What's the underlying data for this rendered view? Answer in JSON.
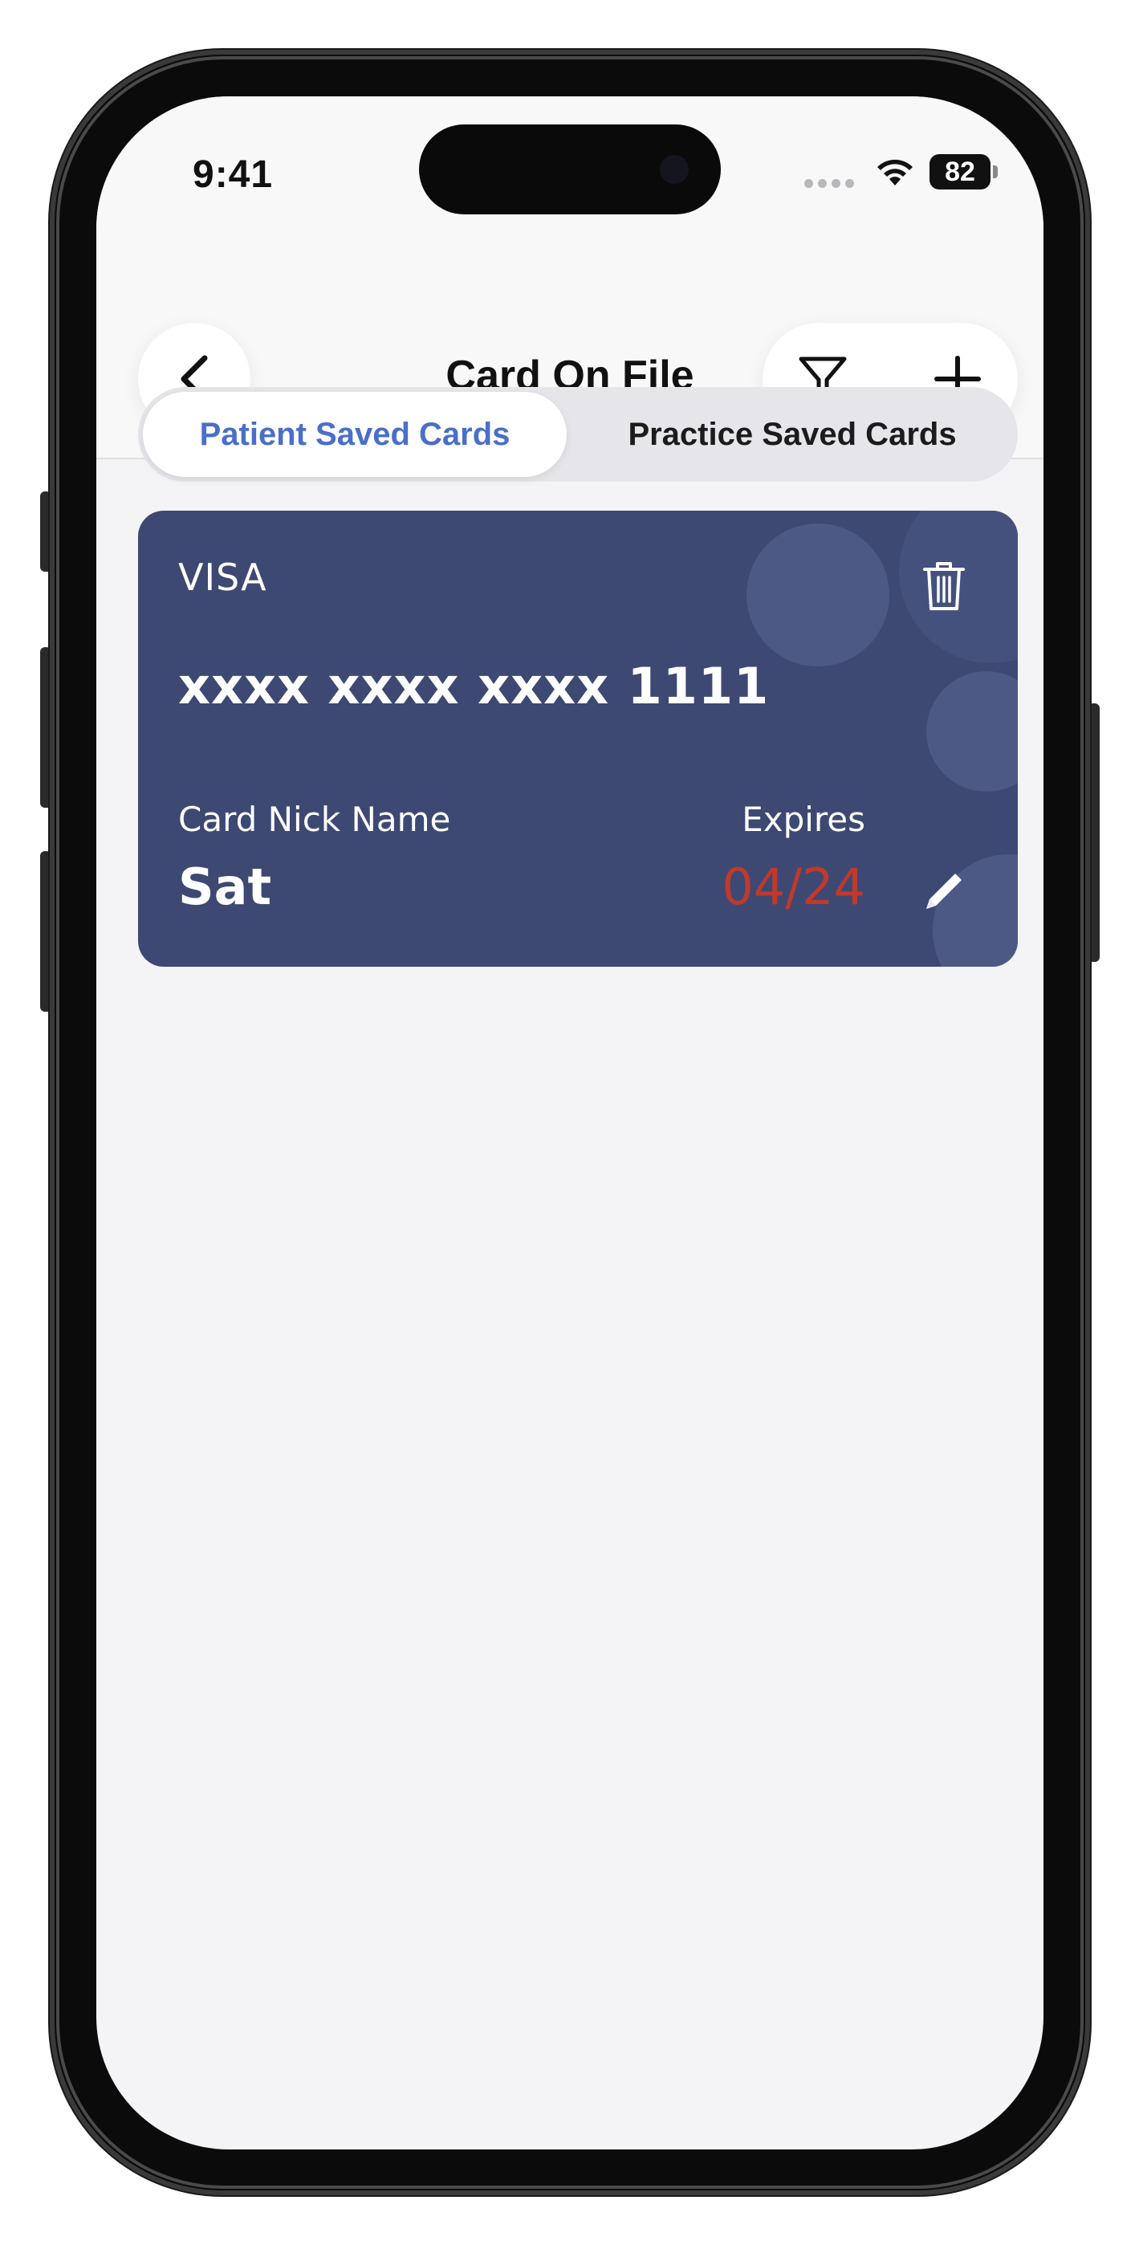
{
  "status_bar": {
    "time": "9:41",
    "battery": "82"
  },
  "nav": {
    "title": "Card On File",
    "back_icon": "chevron-left-icon",
    "filter_icon": "filter-icon",
    "add_icon": "plus-icon"
  },
  "tabs": [
    {
      "label": "Patient Saved Cards",
      "active": true
    },
    {
      "label": "Practice Saved Cards",
      "active": false
    }
  ],
  "cards": [
    {
      "brand": "VISA",
      "number": "xxxx xxxx xxxx 1111",
      "nick_label": "Card Nick Name",
      "nick": "Sat",
      "expires_label": "Expires",
      "expires": "04/24",
      "delete_icon": "trash-icon",
      "edit_icon": "pencil-icon"
    }
  ],
  "colors": {
    "accent": "#4a6fc9",
    "card_bg": "#3d4973",
    "expired": "#c0392b",
    "background": "#f4f4f7"
  }
}
